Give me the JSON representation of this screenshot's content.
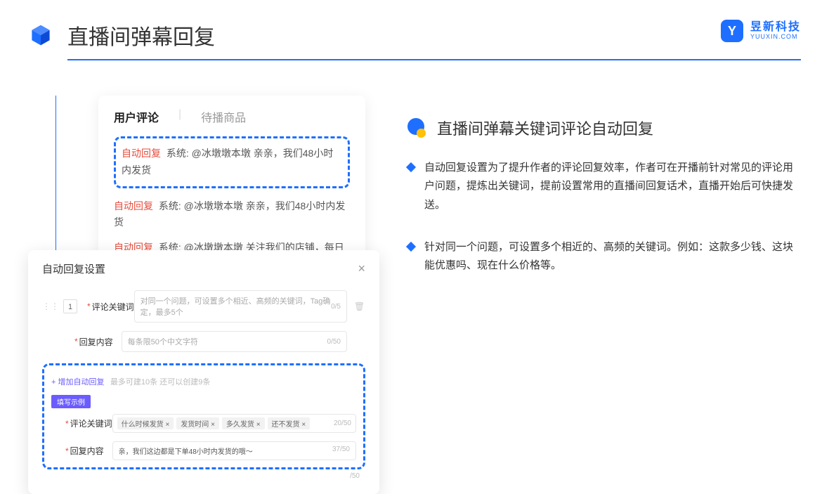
{
  "header": {
    "title": "直播间弹幕回复",
    "brand_cn": "昱新科技",
    "brand_en": "YUUXIN.COM",
    "brand_letter": "Y"
  },
  "comments_card": {
    "tab_active": "用户评论",
    "tab_inactive": "待播商品",
    "highlighted": {
      "tag": "自动回复",
      "text": "系统: @冰墩墩本墩 亲亲，我们48小时内发货"
    },
    "rows": [
      {
        "tag": "自动回复",
        "text": "系统: @冰墩墩本墩 亲亲，我们48小时内发货"
      },
      {
        "tag": "自动回复",
        "text": "系统: @冰墩墩本墩 关注我们的店铺，每日都有热门推荐哟～"
      }
    ]
  },
  "settings_card": {
    "title": "自动回复设置",
    "row_number": "1",
    "label_keyword": "评论关键词",
    "placeholder_keyword": "对同一个问题，可设置多个相近、高频的关键词，Tag确定，最多5个",
    "counter_keyword": "0/5",
    "label_content": "回复内容",
    "placeholder_content": "每条限50个中文字符",
    "counter_content": "0/50",
    "add_link_text": "+ 增加自动回复",
    "add_hint_text": "最多可建10条 还可以创建9条",
    "example_badge": "填写示例",
    "example_keyword_label": "评论关键词",
    "example_tags": [
      "什么时候发货 ×",
      "发货时间 ×",
      "多久发货 ×",
      "还不发货 ×"
    ],
    "example_keyword_counter": "20/50",
    "example_content_label": "回复内容",
    "example_content_value": "亲，我们这边都是下单48小时内发货的哦～",
    "example_content_counter": "37/50",
    "extra_counter": "/50"
  },
  "right": {
    "section_title": "直播间弹幕关键词评论自动回复",
    "bullets": [
      "自动回复设置为了提升作者的评论回复效率，作者可在开播前针对常见的评论用户问题，提炼出关键词，提前设置常用的直播间回复话术，直播开始后可快捷发送。",
      "针对同一个问题，可设置多个相近的、高频的关键词。例如：这款多少钱、这块能优惠吗、现在什么价格等。"
    ]
  }
}
